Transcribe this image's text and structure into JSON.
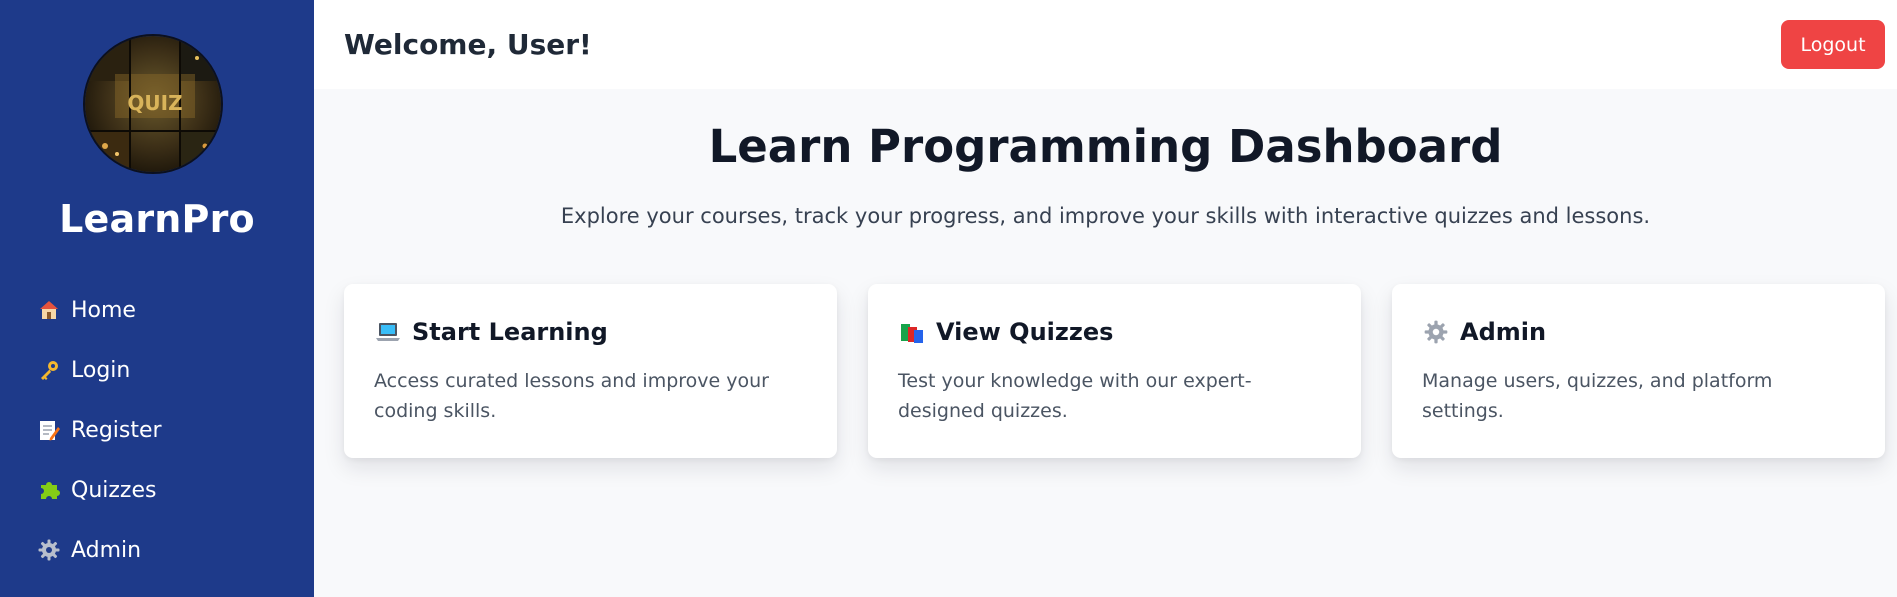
{
  "sidebar": {
    "logo_text": "QUIZ",
    "brand": "LearnPro",
    "items": [
      {
        "label": "Home",
        "icon": "house-icon"
      },
      {
        "label": "Login",
        "icon": "key-icon"
      },
      {
        "label": "Register",
        "icon": "memo-icon"
      },
      {
        "label": "Quizzes",
        "icon": "puzzle-piece-icon"
      },
      {
        "label": "Admin",
        "icon": "gear-icon"
      }
    ]
  },
  "header": {
    "welcome": "Welcome, User!",
    "logout_label": "Logout"
  },
  "main": {
    "title": "Learn Programming Dashboard",
    "subtitle": "Explore your courses, track your progress, and improve your skills with interactive quizzes and lessons.",
    "cards": [
      {
        "title": "Start Learning",
        "icon": "laptop-icon",
        "description": "Access curated lessons and improve your coding skills."
      },
      {
        "title": "View Quizzes",
        "icon": "books-icon",
        "description": "Test your knowledge with our expert-designed quizzes."
      },
      {
        "title": "Admin",
        "icon": "gear-icon",
        "description": "Manage users, quizzes, and platform settings."
      }
    ]
  },
  "colors": {
    "sidebar_bg": "#1e3a8a",
    "logout_bg": "#ef4444",
    "page_bg": "#f8f9fb",
    "card_bg": "#ffffff"
  }
}
